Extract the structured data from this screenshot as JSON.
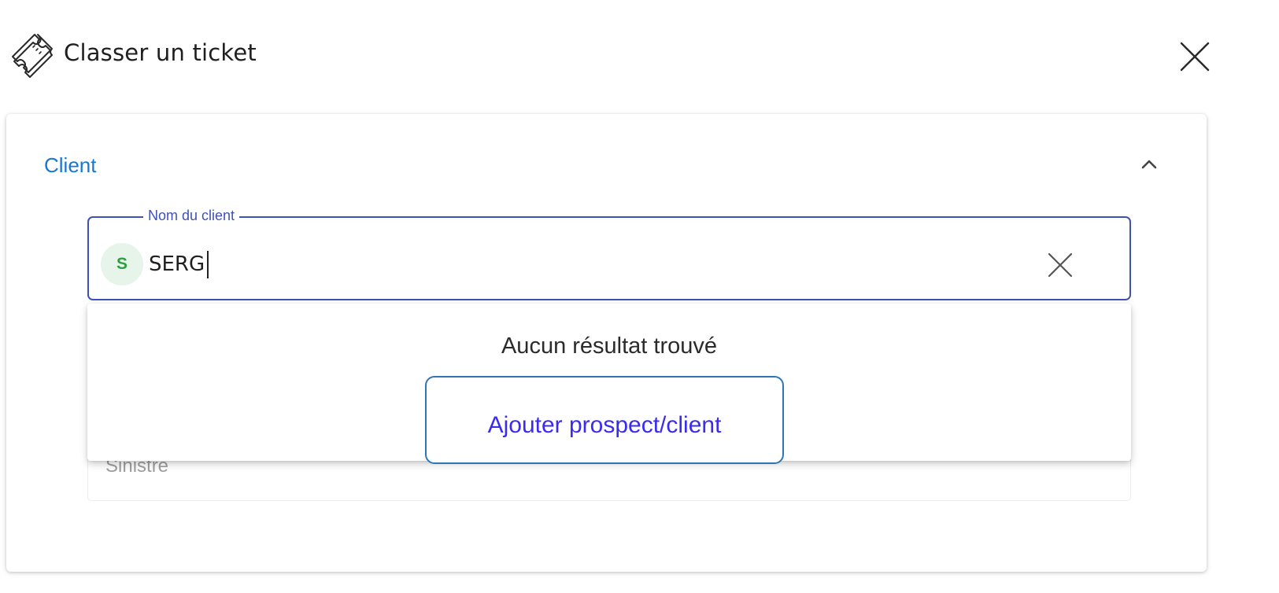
{
  "header": {
    "title": "Classer un ticket",
    "icon": "ticket-icon",
    "close_icon": "close-icon"
  },
  "card": {
    "section_title": "Client",
    "collapse_icon": "chevron-up-icon",
    "client_field": {
      "label": "Nom du client",
      "avatar_letter": "S",
      "value": "SERG",
      "clear_icon": "close-icon"
    },
    "second_field": {
      "placeholder": "Sinistre"
    },
    "dropdown": {
      "no_result_text": "Aucun résultat trouvé",
      "add_button_label": "Ajouter prospect/client"
    }
  },
  "colors": {
    "accent_blue": "#1976d2",
    "field_border": "#3f51b5",
    "avatar_bg": "#e6f4ea",
    "avatar_text": "#2e9e43",
    "add_button_border": "#2e75b6",
    "add_button_text": "#3b2bf0"
  }
}
